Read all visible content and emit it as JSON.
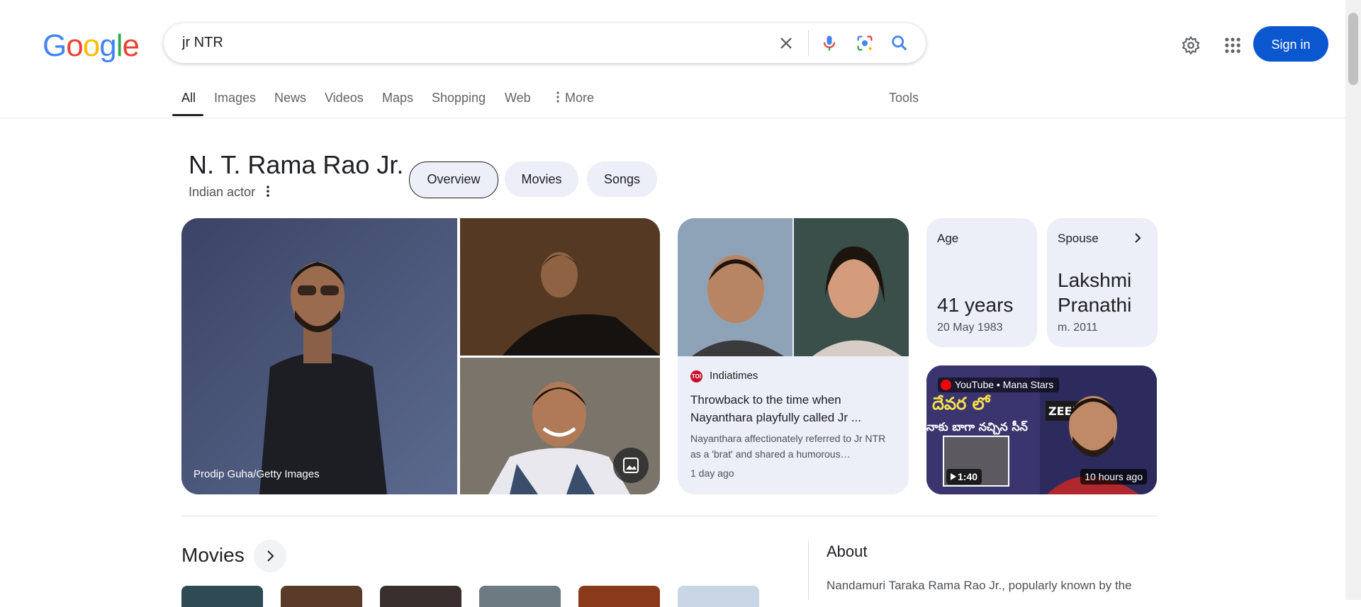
{
  "header": {
    "logo_letters": [
      {
        "char": "G",
        "color": "#4285F4"
      },
      {
        "char": "o",
        "color": "#EA4335"
      },
      {
        "char": "o",
        "color": "#FBBC05"
      },
      {
        "char": "g",
        "color": "#4285F4"
      },
      {
        "char": "l",
        "color": "#34A853"
      },
      {
        "char": "e",
        "color": "#EA4335"
      }
    ],
    "search_query": "jr NTR",
    "sign_in_label": "Sign in",
    "accent_color": "#0b57d0"
  },
  "tabs": {
    "items": [
      "All",
      "Images",
      "News",
      "Videos",
      "Maps",
      "Shopping",
      "Web",
      "More"
    ],
    "active": "All",
    "tools_label": "Tools"
  },
  "entity": {
    "name": "N. T. Rama Rao Jr.",
    "description": "Indian actor",
    "pills": [
      "Overview",
      "Movies",
      "Songs"
    ],
    "active_pill": "Overview"
  },
  "images": {
    "main_caption": "Prodip Guha/Getty Images"
  },
  "news_card": {
    "source": "Indiatimes",
    "favicon_text": "TOI",
    "headline": "Throwback to the time when Nayanthara playfully called Jr ...",
    "snippet": "Nayanthara affectionately referred to Jr NTR as a 'brat' and shared a humorous…",
    "time": "1 day ago"
  },
  "facts": {
    "age": {
      "label": "Age",
      "value": "41 years",
      "detail": "20 May 1983"
    },
    "spouse": {
      "label": "Spouse",
      "value_line1": "Lakshmi",
      "value_line2": "Pranathi",
      "detail": "m. 2011"
    }
  },
  "video_card": {
    "source": "YouTube • Mana Stars",
    "duration": "1:40",
    "posted": "10 hours ago"
  },
  "movies": {
    "title": "Movies",
    "poster_colors": [
      "#2f4a55",
      "#5a3b2a",
      "#3a2f2f",
      "#6c7a82",
      "#8a3a1a",
      "#c9d6e6"
    ]
  },
  "about": {
    "title": "About",
    "text": "Nandamuri Taraka Rama Rao Jr., popularly known by the"
  }
}
